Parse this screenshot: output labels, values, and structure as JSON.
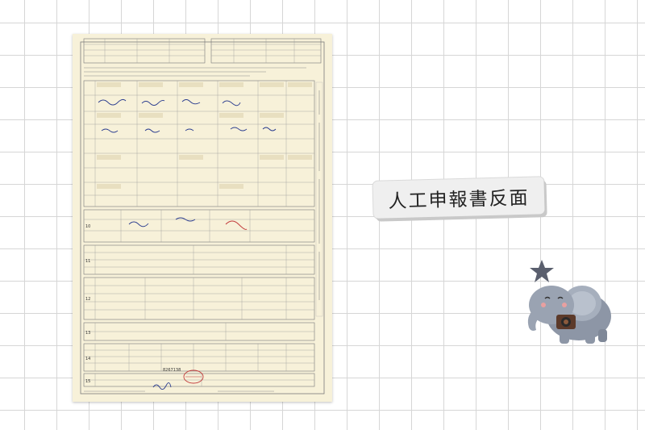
{
  "caption": {
    "text": "人工申報書反面"
  },
  "form": {
    "sections": [
      "10",
      "11",
      "12",
      "13",
      "14",
      "15"
    ],
    "stamp_number": "8267138"
  },
  "icons": {
    "form": "scanned-tax-form-icon",
    "mascot": "elephant-mascot-icon",
    "star": "star-icon"
  },
  "colors": {
    "paper": "#f7f1d9",
    "caption_card": "#efefef",
    "stamp": "#c23b3b",
    "ink": "#2b3d8f"
  }
}
